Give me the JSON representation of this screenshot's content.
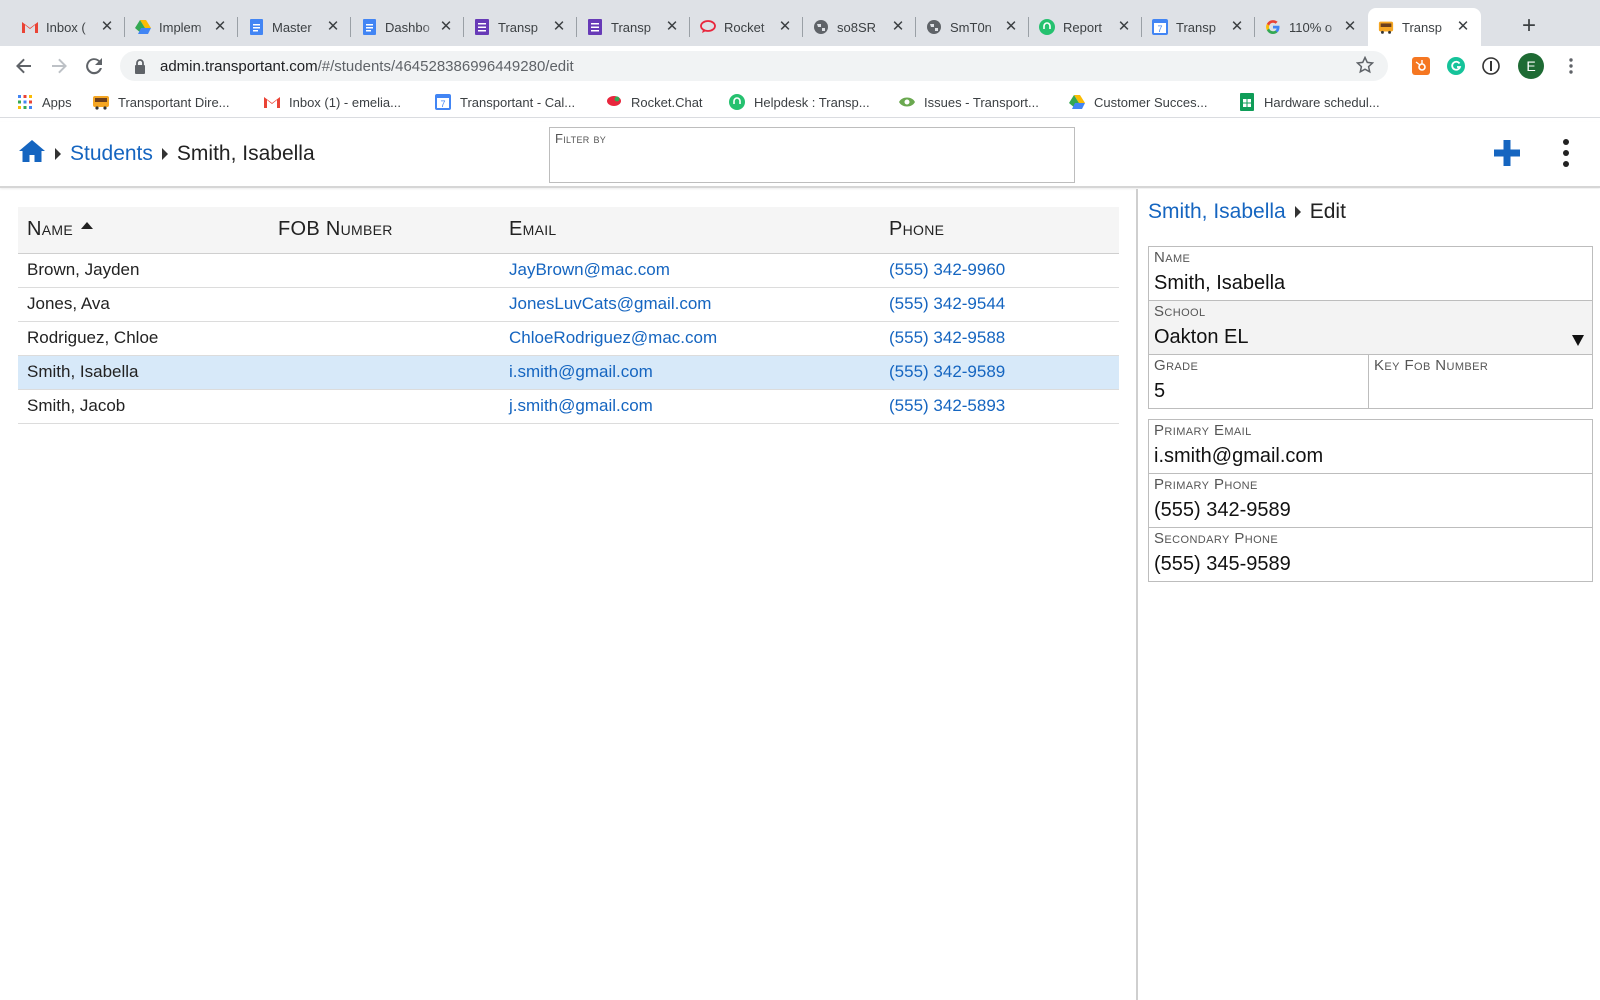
{
  "browser": {
    "tabs": [
      {
        "title": "Inbox (",
        "icon": "gmail-icon"
      },
      {
        "title": "Implem",
        "icon": "drive-icon"
      },
      {
        "title": "Master",
        "icon": "docs-icon"
      },
      {
        "title": "Dashbo",
        "icon": "docs-icon"
      },
      {
        "title": "Transp",
        "icon": "forms-icon"
      },
      {
        "title": "Transp",
        "icon": "forms-icon"
      },
      {
        "title": "Rocket",
        "icon": "rocketchat-icon"
      },
      {
        "title": "so8SR",
        "icon": "globe-icon"
      },
      {
        "title": "SmT0n",
        "icon": "globe-icon"
      },
      {
        "title": "Report",
        "icon": "helpdesk-icon"
      },
      {
        "title": "Transp",
        "icon": "calendar-icon"
      },
      {
        "title": "110% o",
        "icon": "google-icon"
      },
      {
        "title": "Transp",
        "icon": "bus-icon"
      }
    ],
    "active_tab": 12,
    "url_host": "admin.transportant.com",
    "url_path": "/#/students/464528386996449280/edit",
    "profile_initial": "E",
    "bookmarks": [
      {
        "label": "Apps",
        "icon": "apps-grid-icon"
      },
      {
        "label": "Transportant Dire...",
        "icon": "bus-icon"
      },
      {
        "label": "Inbox (1) - emelia...",
        "icon": "gmail-icon"
      },
      {
        "label": "Transportant - Cal...",
        "icon": "calendar-icon"
      },
      {
        "label": "Rocket.Chat",
        "icon": "rocketchat-icon"
      },
      {
        "label": "Helpdesk : Transp...",
        "icon": "helpdesk-icon"
      },
      {
        "label": "Issues - Transport...",
        "icon": "issues-icon"
      },
      {
        "label": "Customer Succes...",
        "icon": "drive-icon"
      },
      {
        "label": "Hardware schedul...",
        "icon": "sheets-icon"
      }
    ]
  },
  "app": {
    "breadcrumb": {
      "section": "Students",
      "current": "Smith, Isabella"
    },
    "filter": {
      "label": "Filter by",
      "value": ""
    },
    "accent": "#1565c0",
    "table": {
      "headers": [
        "Name",
        "FOB Number",
        "Email",
        "Phone"
      ],
      "rows": [
        {
          "name": "Brown, Jayden",
          "fob": "",
          "email": "JayBrown@mac.com",
          "phone": "(555) 342-9960"
        },
        {
          "name": "Jones, Ava",
          "fob": "",
          "email": "JonesLuvCats@gmail.com",
          "phone": "(555) 342-9544"
        },
        {
          "name": "Rodriguez, Chloe",
          "fob": "",
          "email": "ChloeRodriguez@mac.com",
          "phone": "(555) 342-9588"
        },
        {
          "name": "Smith, Isabella",
          "fob": "",
          "email": "i.smith@gmail.com",
          "phone": "(555) 342-9589"
        },
        {
          "name": "Smith, Jacob",
          "fob": "",
          "email": "j.smith@gmail.com",
          "phone": "(555) 342-5893"
        }
      ],
      "selected_row": 3
    },
    "edit": {
      "breadcrumb": {
        "parent": "Smith, Isabella",
        "current": "Edit"
      },
      "name": {
        "label": "Name",
        "value": "Smith, Isabella"
      },
      "school": {
        "label": "School",
        "value": "Oakton EL"
      },
      "grade": {
        "label": "Grade",
        "value": "5"
      },
      "fob": {
        "label": "Key Fob Number",
        "value": ""
      },
      "email": {
        "label": "Primary Email",
        "value": "i.smith@gmail.com"
      },
      "phone": {
        "label": "Primary Phone",
        "value": "(555) 342-9589"
      },
      "phone2": {
        "label": "Secondary Phone",
        "value": "(555) 345-9589"
      }
    }
  }
}
